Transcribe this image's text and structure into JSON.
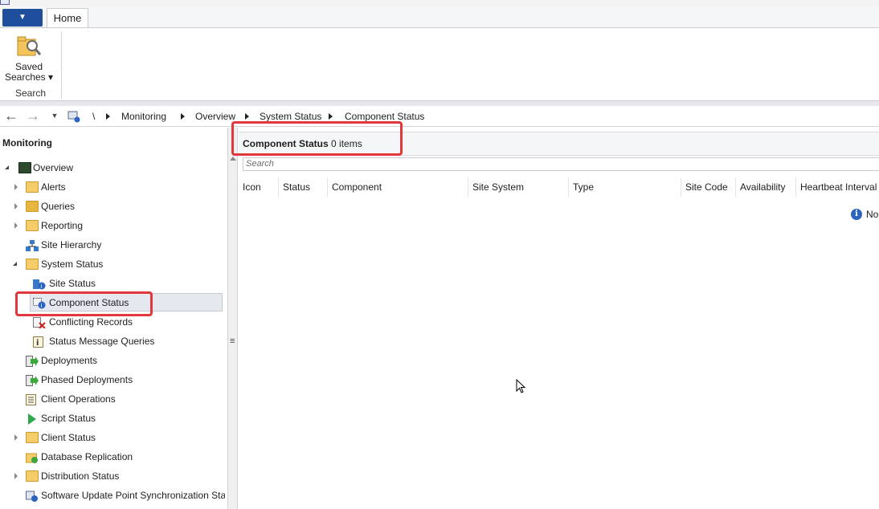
{
  "ribbon": {
    "tabs": [
      {
        "label": "Home"
      }
    ],
    "saved_searches_line1": "Saved",
    "saved_searches_line2": "Searches",
    "group_label": "Search"
  },
  "breadcrumb": {
    "root": "\\",
    "items": [
      "Monitoring",
      "Overview",
      "System Status",
      "Component Status"
    ]
  },
  "left_pane": {
    "header": "Monitoring",
    "tree": {
      "overview": "Overview",
      "alerts": "Alerts",
      "queries": "Queries",
      "reporting": "Reporting",
      "site_hierarchy": "Site Hierarchy",
      "system_status": "System Status",
      "site_status": "Site Status",
      "component_status": "Component Status",
      "conflicting_records": "Conflicting Records",
      "status_message_queries": "Status Message Queries",
      "deployments": "Deployments",
      "phased_deployments": "Phased Deployments",
      "client_operations": "Client Operations",
      "script_status": "Script Status",
      "client_status": "Client Status",
      "database_replication": "Database Replication",
      "distribution_status": "Distribution Status",
      "sup_sync": "Software Update Point Synchronization Sta"
    }
  },
  "right_pane": {
    "title_bold": "Component Status",
    "title_count": "0 items",
    "search_placeholder": "Search",
    "columns": [
      "Icon",
      "Status",
      "Component",
      "Site System",
      "Type",
      "Site Code",
      "Availability",
      "Heartbeat Interval"
    ],
    "info_text": "No"
  },
  "colors": {
    "highlight": "#e0383d",
    "app_menu": "#1f4e9c"
  }
}
